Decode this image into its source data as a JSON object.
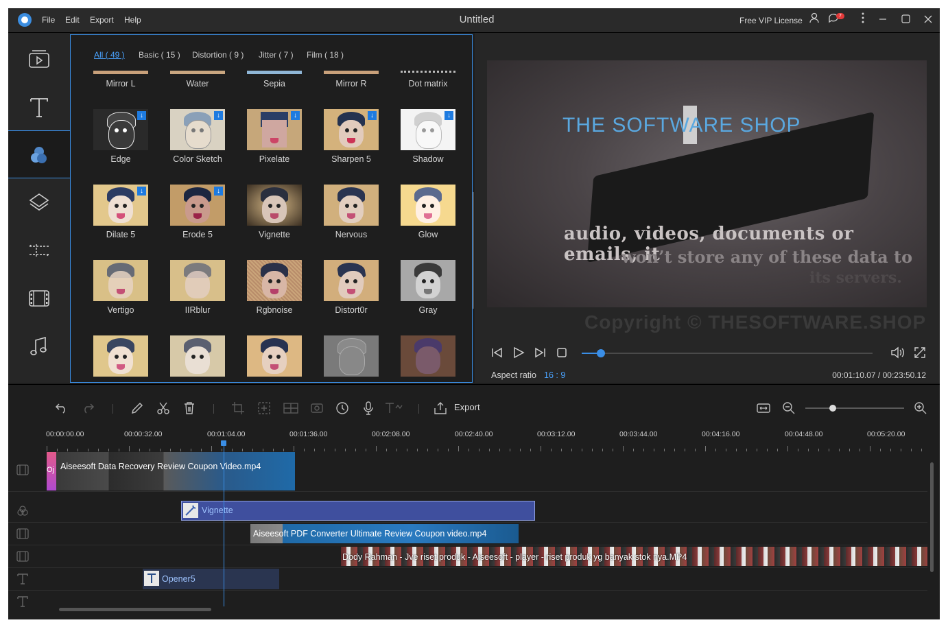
{
  "titlebar": {
    "menu": [
      "File",
      "Edit",
      "Export",
      "Help"
    ],
    "title": "Untitled",
    "license": "Free VIP License",
    "notifications": "7"
  },
  "sidebar": {
    "items": [
      "media-icon",
      "text-icon",
      "filters-icon",
      "overlays-icon",
      "transitions-icon",
      "elements-icon",
      "music-icon"
    ],
    "active": "filters-icon"
  },
  "filters": {
    "tabs": [
      "All ( 49 )",
      "Basic ( 15 )",
      "Distortion ( 9 )",
      "Jitter ( 7 )",
      "Film ( 18 )"
    ],
    "active_tab": "All ( 49 )",
    "row0": [
      "Mirror L",
      "Water",
      "Sepia",
      "Mirror R",
      "Dot matrix"
    ],
    "row1": [
      "Edge",
      "Color Sketch",
      "Pixelate",
      "Sharpen 5",
      "Shadow"
    ],
    "row2": [
      "Dilate 5",
      "Erode 5",
      "Vignette",
      "Nervous",
      "Glow"
    ],
    "row3": [
      "Vertigo",
      "IIRblur",
      "Rgbnoise",
      "Distort0r",
      "Gray"
    ]
  },
  "preview": {
    "title_text": "THE SOFTWARE SHOP",
    "caption_line1": "audio, videos, documents or emails, it",
    "caption_line2": "won’t store any of these data to",
    "caption_line3": "its servers.",
    "watermark": "Copyright © THESOFTWARE.SHOP",
    "aspect_label": "Aspect ratio",
    "aspect_value": "16 : 9",
    "timecode": "00:01:10.07 / 00:23:50.12",
    "progress": 0.049
  },
  "toolbar": {
    "export_label": "Export",
    "zoom_level": 0.24
  },
  "ruler": {
    "labels": [
      "00:00:00.00",
      "00:00:32.00",
      "00:01:04.00",
      "00:01:36.00",
      "00:02:08.00",
      "00:02:40.00",
      "00:03:12.00",
      "00:03:44.00",
      "00:04:16.00",
      "00:04:48.00",
      "00:05:20.00"
    ]
  },
  "timeline": {
    "clip_video1": "Aiseesoft Data Recovery Review Coupon Video.mp4",
    "clip_video1_prefix": "Oj",
    "clip_filter": "Vignette",
    "clip_video2": "Aiseesoft PDF Converter Ultimate Review Coupon video.mp4",
    "clip_video3": "Dody Rahman - Jve riset produk - Aiseesoft - player - riset produk yg banyak stok nya.MP4",
    "clip_text": "Opener5"
  },
  "colors": {
    "accent": "#3a8ee6",
    "filter_clip": "#3f4f9e",
    "text_clip": "#2a3550",
    "video_clip": "#1f5a8a"
  }
}
